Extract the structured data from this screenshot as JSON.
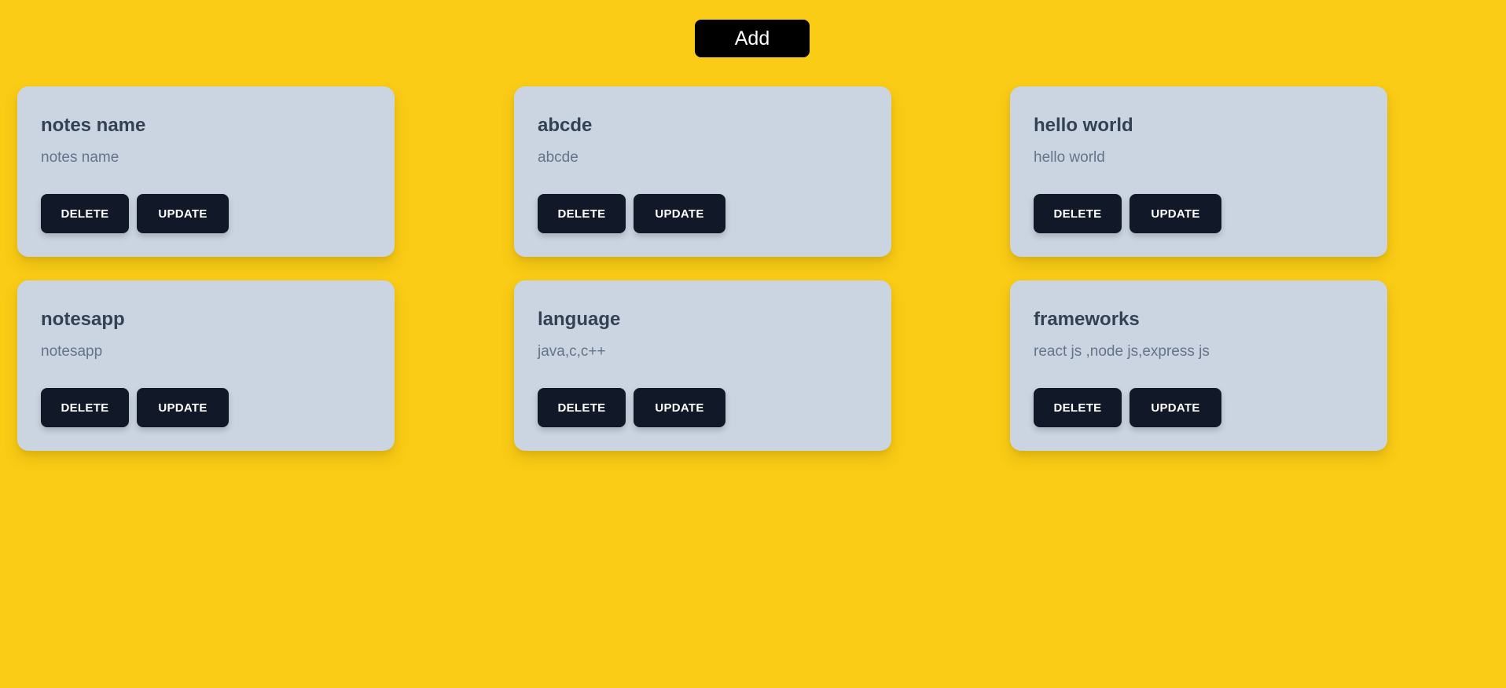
{
  "header": {
    "add_label": "Add"
  },
  "notes": [
    {
      "title": "notes name",
      "body": "notes name",
      "delete_label": "DELETE",
      "update_label": "UPDATE"
    },
    {
      "title": "abcde",
      "body": "abcde",
      "delete_label": "DELETE",
      "update_label": "UPDATE"
    },
    {
      "title": "hello world",
      "body": "hello world",
      "delete_label": "DELETE",
      "update_label": "UPDATE"
    },
    {
      "title": "notesapp",
      "body": "notesapp",
      "delete_label": "DELETE",
      "update_label": "UPDATE"
    },
    {
      "title": "language",
      "body": "java,c,c++",
      "delete_label": "DELETE",
      "update_label": "UPDATE"
    },
    {
      "title": "frameworks",
      "body": "react js ,node js,express js",
      "delete_label": "DELETE",
      "update_label": "UPDATE"
    }
  ],
  "colors": {
    "background": "#facc15",
    "card": "#cbd5e1",
    "button": "#111827",
    "add_button": "#000000",
    "title_text": "#334155",
    "body_text": "#64748b"
  }
}
